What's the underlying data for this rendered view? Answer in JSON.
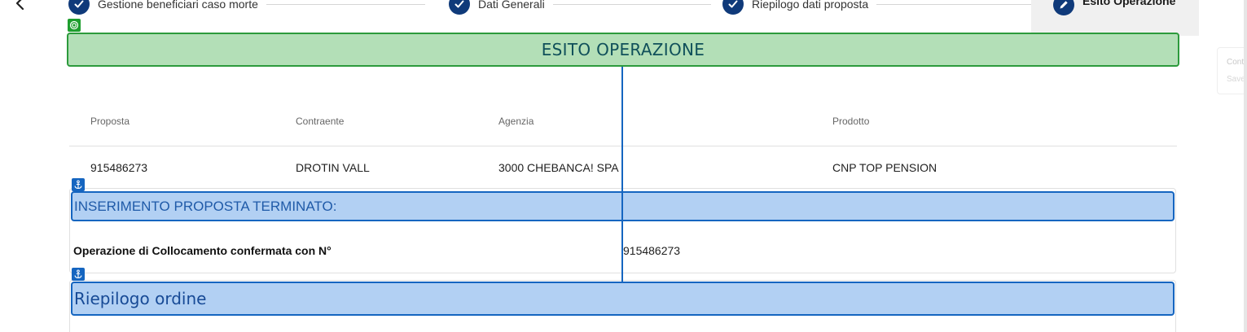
{
  "stepper": {
    "steps": [
      {
        "label": "Gestione beneficiari caso morte",
        "state": "done"
      },
      {
        "label": "Dati Generali",
        "state": "done"
      },
      {
        "label": "Riepilogo dati proposta",
        "state": "done"
      },
      {
        "label": "Esito Operazione",
        "state": "active"
      }
    ]
  },
  "ghost_panel": {
    "line1": "Cont",
    "line2": "Save"
  },
  "outcome": {
    "title": "ESITO OPERAZIONE"
  },
  "summary_table": {
    "headers": [
      "Proposta",
      "Contraente",
      "Agenzia",
      "Prodotto"
    ],
    "row": [
      "915486273",
      "DROTIN VALL",
      "3000 CHEBANCA! SPA",
      "CNP TOP PENSION"
    ]
  },
  "insertion_section": {
    "title": "INSERIMENTO PROPOSTA TERMINATO:",
    "confirmation_label": "Operazione di Collocamento confermata con N°",
    "confirmation_value": "915486273"
  },
  "order_summary": {
    "title": "Riepilogo ordine"
  },
  "colors": {
    "stepper_circle": "#0f3a7a",
    "outcome_bg": "#b3dfb7",
    "outcome_border": "#2c9a3c",
    "section_bg": "#b2d0f3",
    "section_border": "#1565c0"
  },
  "icons": [
    "chevron-left-icon",
    "check-icon",
    "pencil-icon",
    "target-icon",
    "anchor-icon"
  ]
}
